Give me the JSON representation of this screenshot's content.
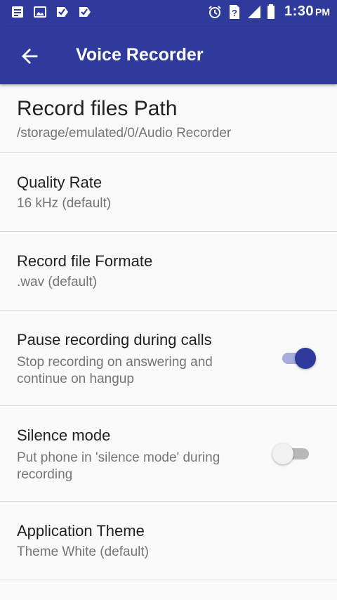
{
  "status_bar": {
    "time": "1:30",
    "ampm": "PM",
    "left_icons": [
      "doc-notification-icon",
      "image-notification-icon",
      "task-check-icon",
      "task-check-icon"
    ],
    "right_icons": [
      "alarm-icon",
      "unknown-sim-icon",
      "signal-icon",
      "battery-icon"
    ]
  },
  "app_bar": {
    "title": "Voice Recorder",
    "back_icon": "arrow-left-icon",
    "color": "#2f3b9c"
  },
  "settings": {
    "path": {
      "title": "Record files Path",
      "subtitle": "/storage/emulated/0/Audio Recorder"
    },
    "quality": {
      "title": "Quality Rate",
      "subtitle": "16 kHz (default)"
    },
    "format": {
      "title": "Record file Formate",
      "subtitle": ".wav (default)"
    },
    "pause": {
      "title": "Pause recording during calls",
      "subtitle": "Stop recording on answering and continue on hangup",
      "enabled": true
    },
    "silence": {
      "title": "Silence mode",
      "subtitle": "Put phone in 'silence mode' during recording",
      "enabled": false
    },
    "theme": {
      "title": "Application Theme",
      "subtitle": "Theme White (default)"
    }
  }
}
